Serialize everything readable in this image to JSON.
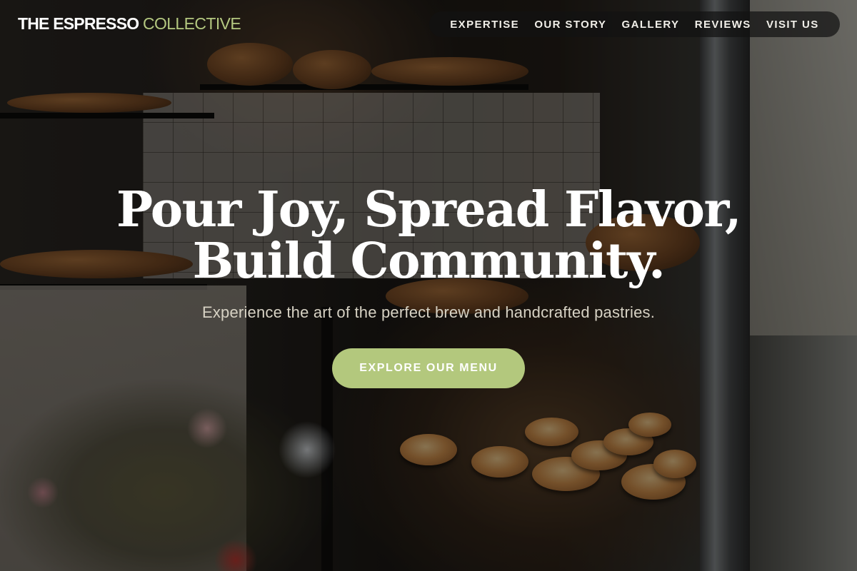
{
  "header": {
    "logo_main": "THE ESPRESSO",
    "logo_accent": "COLLECTIVE",
    "nav": [
      {
        "label": "EXPERTISE"
      },
      {
        "label": "OUR STORY"
      },
      {
        "label": "GALLERY"
      },
      {
        "label": "REVIEWS"
      },
      {
        "label": "VISIT US"
      }
    ]
  },
  "hero": {
    "headline_line1": "Pour Joy, Spread Flavor,",
    "headline_line2": "Build Community.",
    "subtitle": "Experience the art of the perfect brew and handcrafted pastries.",
    "cta_label": "EXPLORE OUR MENU"
  },
  "colors": {
    "accent": "#b3c87d",
    "overlay": "#000000"
  }
}
